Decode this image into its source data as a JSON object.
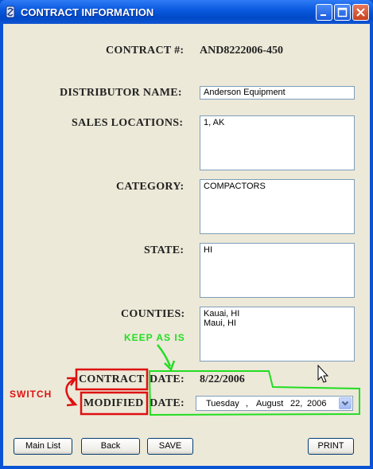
{
  "window": {
    "title": "CONTRACT INFORMATION"
  },
  "form": {
    "contract_label": "CONTRACT #:",
    "contract_value": "AND8222006-450",
    "distributor_label": "DISTRIBUTOR NAME:",
    "distributor_value": "Anderson Equipment",
    "sales_locations_label": "SALES LOCATIONS:",
    "sales_locations_value": "1, AK",
    "category_label": "CATEGORY:",
    "category_value": "COMPACTORS",
    "state_label": "STATE:",
    "state_value": "HI",
    "counties_label": "COUNTIES:",
    "counties_value": "Kauai, HI\nMaui, HI",
    "contract_date_label_word": "CONTRACT",
    "contract_date_label_suffix": "DATE:",
    "contract_date_value": "8/22/2006",
    "modified_date_label_word": "MODIFIED",
    "modified_date_label_suffix": "DATE:",
    "modified_date": {
      "weekday": "Tuesday",
      "sep1": ",",
      "month": "August",
      "day": "22,",
      "year": "2006"
    }
  },
  "buttons": {
    "main_list": "Main List",
    "back": "Back",
    "save": "SAVE",
    "print": "PRINT"
  },
  "annotations": {
    "keep_as_is": "KEEP AS IS",
    "switch": "SWITCH",
    "green": "#22dd22",
    "red": "#dd1111"
  },
  "colors": {
    "title_bar": "#0b5ae0",
    "client_bg": "#ece9d8"
  }
}
